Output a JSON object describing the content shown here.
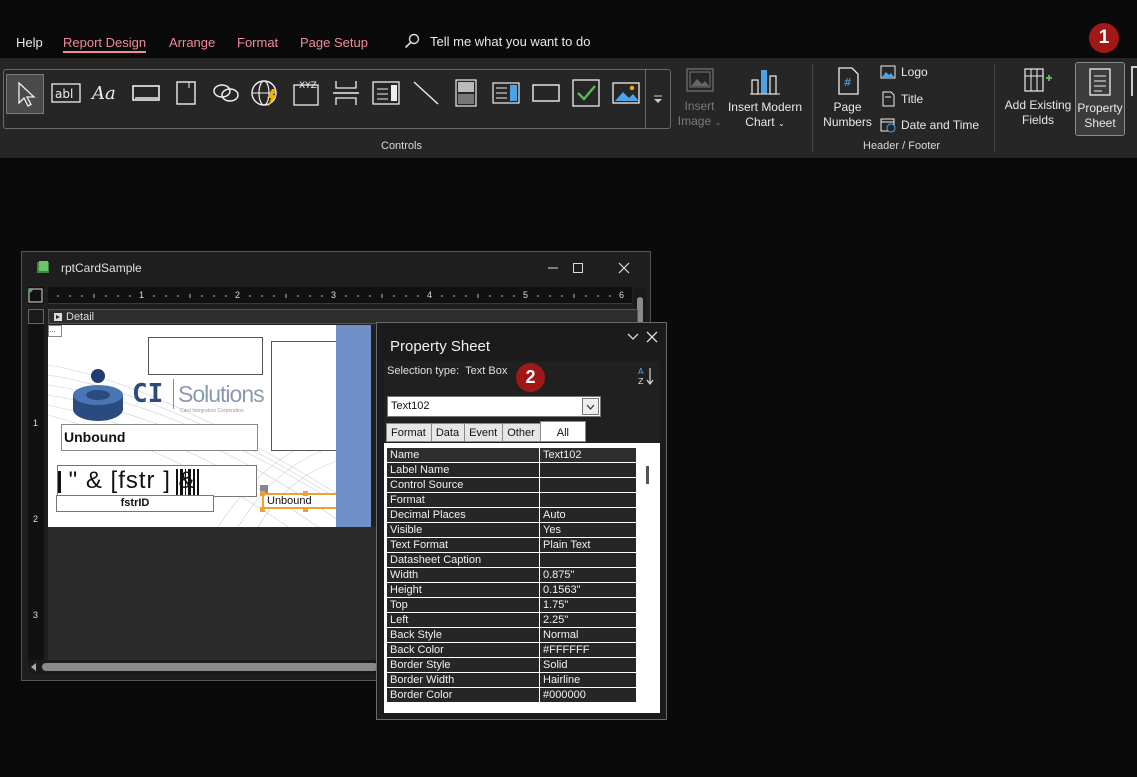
{
  "menu": {
    "tabs": [
      "Help",
      "Report Design",
      "Arrange",
      "Format",
      "Page Setup"
    ],
    "active_tab": "Report Design",
    "tell_me": "Tell me what you want to do"
  },
  "callouts": {
    "one": "1",
    "two": "2"
  },
  "ribbon": {
    "controls_group_label": "Controls",
    "header_footer_group_label": "Header / Footer",
    "insert_image": "Insert Image",
    "insert_image_line1": "Insert",
    "insert_image_line2": "Image",
    "insert_modern_chart_line1": "Insert Modern",
    "insert_modern_chart_line2": "Chart",
    "page_numbers_line1": "Page",
    "page_numbers_line2": "Numbers",
    "logo": "Logo",
    "title": "Title",
    "date_and_time": "Date and Time",
    "add_existing_fields_line1": "Add Existing",
    "add_existing_fields_line2": "Fields",
    "property_sheet_line1": "Property",
    "property_sheet_line2": "Sheet"
  },
  "report_window": {
    "title": "rptCardSample",
    "section": "Detail",
    "ruler_numbers": [
      "1",
      "2",
      "3",
      "4",
      "5",
      "6"
    ],
    "vruler_numbers": [
      "1",
      "2",
      "3"
    ],
    "unbound_large": "Unbound",
    "barcode_expr": "\" & [fstr ] & ",
    "fstrid": "fstrID",
    "unbound_selected": "Unbound",
    "logo_ci": "CI",
    "logo_solutions": "Solutions",
    "logo_tagline": "Card Integrators Corporation"
  },
  "property_sheet": {
    "title": "Property Sheet",
    "selection_type_label": "Selection type:",
    "selection_type_value": "Text Box",
    "selected_control": "Text102",
    "tabs": [
      "Format",
      "Data",
      "Event",
      "Other",
      "All"
    ],
    "active_tab": "All",
    "rows": [
      {
        "k": "Name",
        "v": "Text102"
      },
      {
        "k": "Label Name",
        "v": ""
      },
      {
        "k": "Control Source",
        "v": ""
      },
      {
        "k": "Format",
        "v": ""
      },
      {
        "k": "Decimal Places",
        "v": "Auto"
      },
      {
        "k": "Visible",
        "v": "Yes"
      },
      {
        "k": "Text Format",
        "v": "Plain Text"
      },
      {
        "k": "Datasheet Caption",
        "v": ""
      },
      {
        "k": "Width",
        "v": "0.875\""
      },
      {
        "k": "Height",
        "v": "0.1563\""
      },
      {
        "k": "Top",
        "v": "1.75\""
      },
      {
        "k": "Left",
        "v": "2.25\""
      },
      {
        "k": "Back Style",
        "v": "Normal"
      },
      {
        "k": "Back Color",
        "v": "#FFFFFF"
      },
      {
        "k": "Border Style",
        "v": "Solid"
      },
      {
        "k": "Border Width",
        "v": "Hairline"
      },
      {
        "k": "Border Color",
        "v": "#000000"
      }
    ]
  },
  "colors": {
    "accent_pink": "#f08a9c",
    "badge_red": "#a01818",
    "selection_orange": "#f0a030",
    "band_blue": "#6f8fc9"
  }
}
